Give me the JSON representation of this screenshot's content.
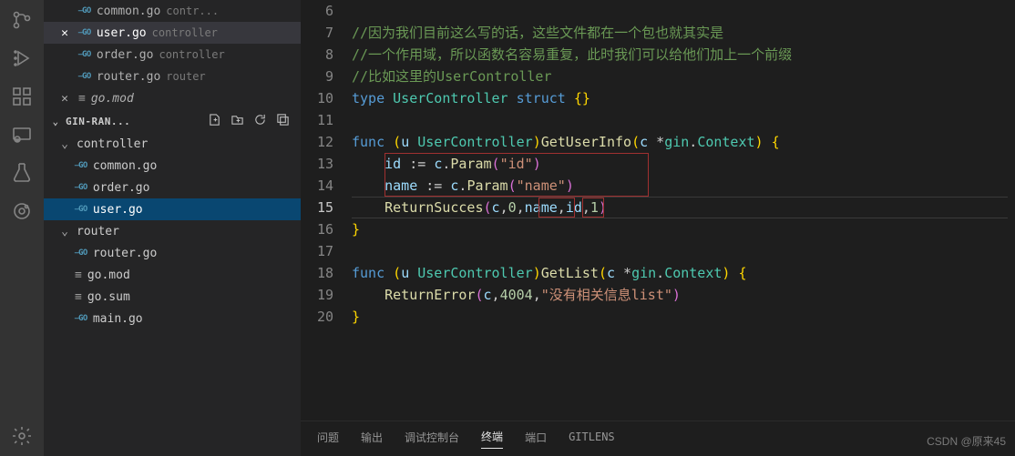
{
  "open_editors": [
    {
      "filename": "common.go",
      "dir": "contr...",
      "close": false,
      "icon": "go"
    },
    {
      "filename": "user.go",
      "dir": "controller",
      "close": true,
      "icon": "go",
      "active": true
    },
    {
      "filename": "order.go",
      "dir": "controller",
      "close": false,
      "icon": "go"
    },
    {
      "filename": "router.go",
      "dir": "router",
      "close": false,
      "icon": "go"
    },
    {
      "filename": "go.mod",
      "dir": "",
      "close": true,
      "icon": "lines",
      "italic": true
    }
  ],
  "tree": {
    "header": "GIN-RAN...",
    "items": [
      {
        "type": "folder",
        "label": "controller",
        "depth": 0
      },
      {
        "type": "file",
        "label": "common.go",
        "depth": 1,
        "icon": "go"
      },
      {
        "type": "file",
        "label": "order.go",
        "depth": 1,
        "icon": "go"
      },
      {
        "type": "file",
        "label": "user.go",
        "depth": 1,
        "icon": "go",
        "active": true
      },
      {
        "type": "folder",
        "label": "router",
        "depth": 0
      },
      {
        "type": "file",
        "label": "router.go",
        "depth": 1,
        "icon": "go"
      },
      {
        "type": "file",
        "label": "go.mod",
        "depth": 0,
        "icon": "lines"
      },
      {
        "type": "file",
        "label": "go.sum",
        "depth": 0,
        "icon": "lines"
      },
      {
        "type": "file",
        "label": "main.go",
        "depth": 0,
        "icon": "go"
      }
    ]
  },
  "code": {
    "line_numbers": [
      6,
      7,
      8,
      9,
      10,
      11,
      12,
      13,
      14,
      15,
      16,
      17,
      18,
      19,
      20
    ],
    "current_line": 15,
    "lines": {
      "6": "",
      "7_comment": "//因为我们目前这么写的话，这些文件都在一个包也就其实是",
      "8_comment": "//一个作用域，所以函数名容易重复，此时我们可以给他们加上一个前缀",
      "9_comment": "//比如这里的UserController",
      "10_type": "type",
      "10_name": "UserController",
      "10_struct": "struct",
      "10_braces": "{}",
      "12_func": "func",
      "12_recv_var": "u",
      "12_recv_type": "UserController",
      "12_fn": "GetUserInfo",
      "12_param": "c",
      "12_ptr": "*",
      "12_pkg": "gin",
      "12_ctx": "Context",
      "13_id": "id",
      "13_assign": ":=",
      "13_c": "c",
      "13_param": "Param",
      "13_str": "\"id\"",
      "14_name": "name",
      "14_assign": ":=",
      "14_c": "c",
      "14_param": "Param",
      "14_str": "\"name\"",
      "15_fn": "ReturnSucces",
      "15_c": "c",
      "15_z": "0",
      "15_name": "name",
      "15_id": "id",
      "15_one": "1",
      "18_func": "func",
      "18_recv_var": "u",
      "18_recv_type": "UserController",
      "18_fn": "GetList",
      "18_param": "c",
      "18_ptr": "*",
      "18_pkg": "gin",
      "18_ctx": "Context",
      "19_fn": "ReturnError",
      "19_c": "c",
      "19_code": "4004",
      "19_str": "\"没有相关信息list\""
    }
  },
  "panel": {
    "tabs": [
      "问题",
      "输出",
      "调试控制台",
      "终端",
      "端口",
      "GITLENS"
    ],
    "active": 3
  },
  "watermark": "CSDN @原来45"
}
